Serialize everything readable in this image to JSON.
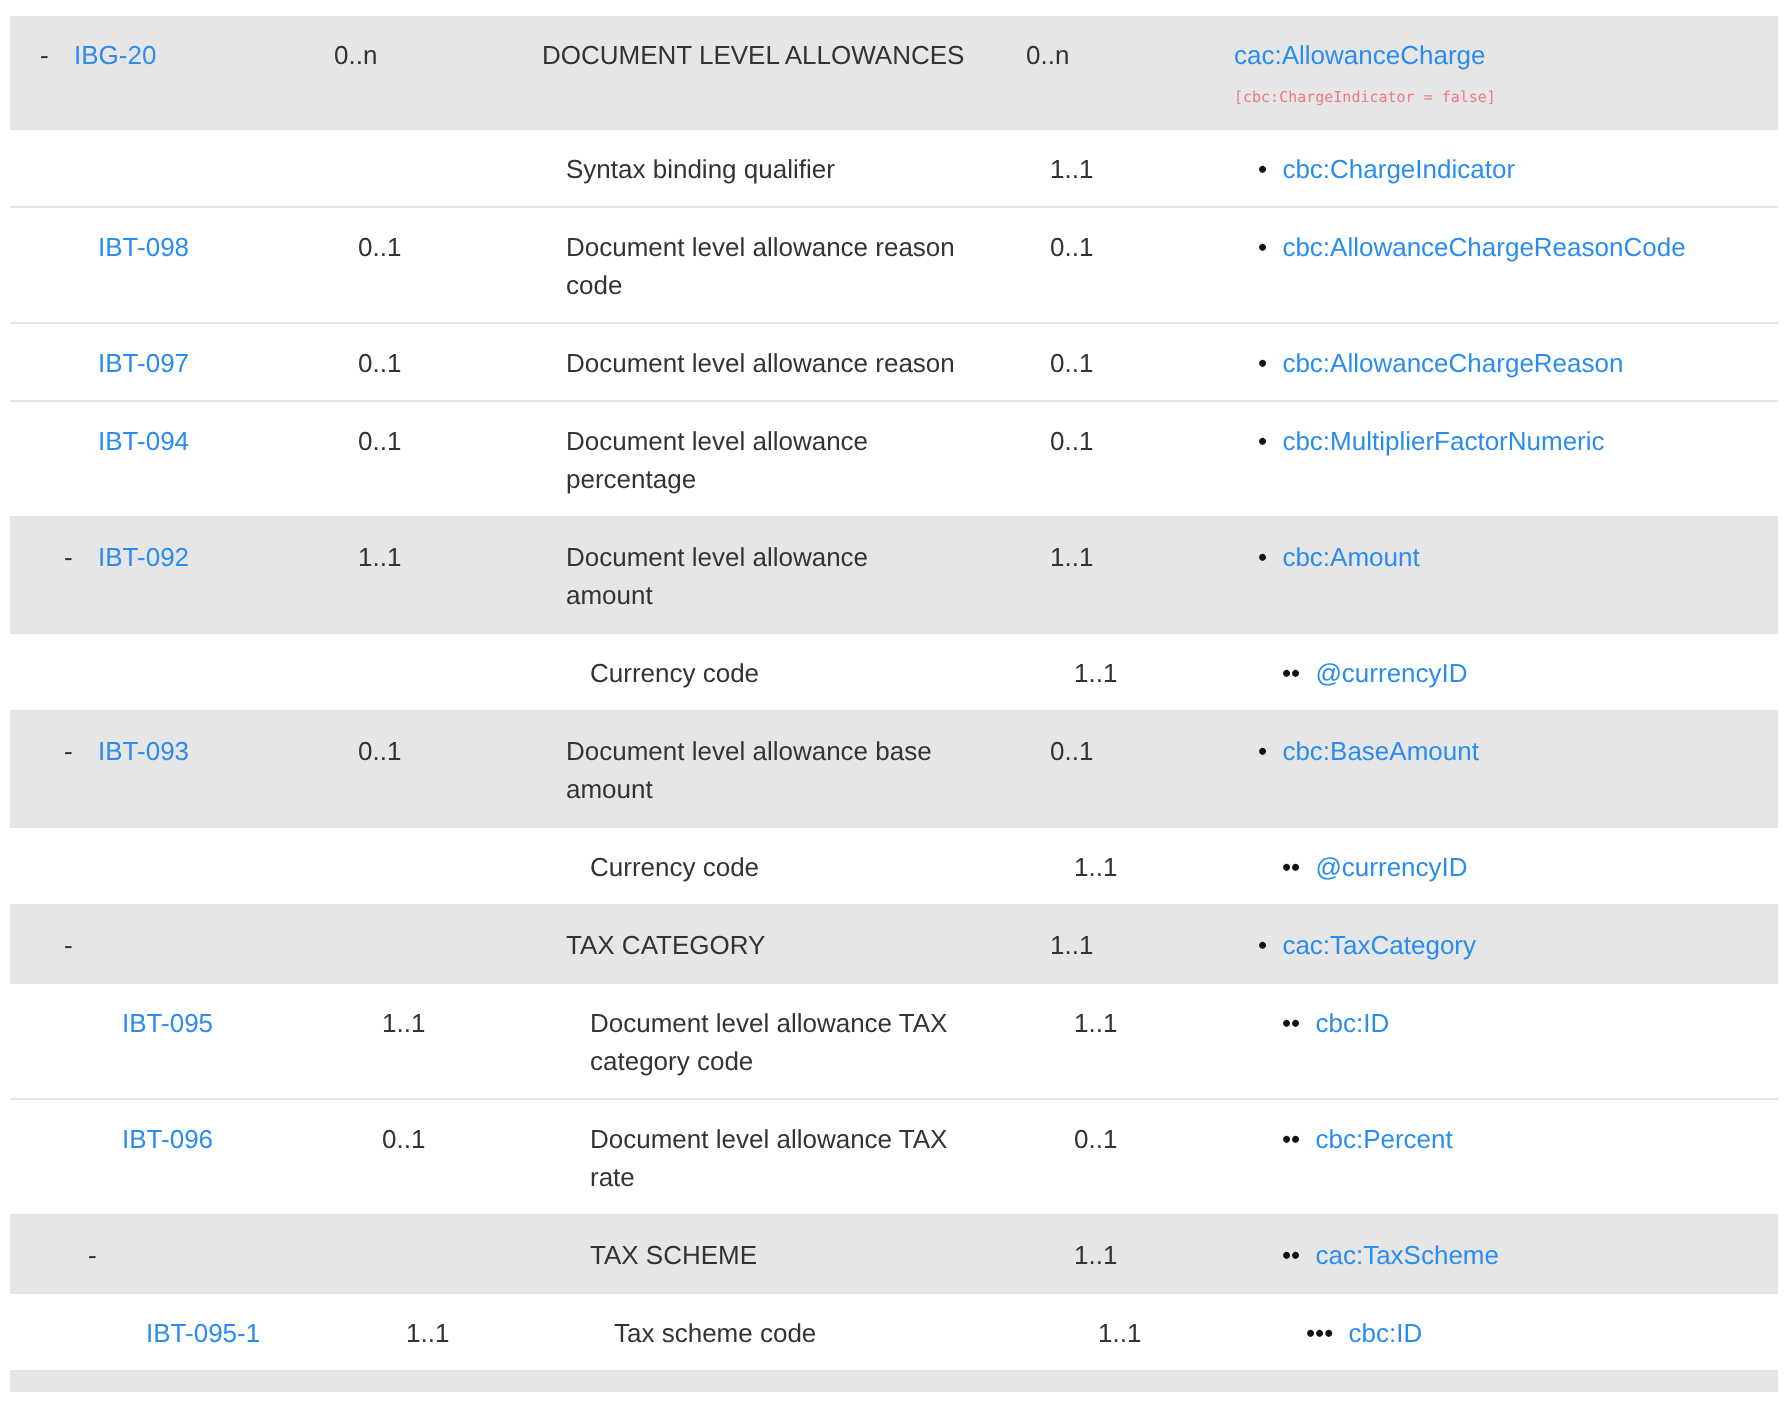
{
  "rows": [
    {
      "toggle": "-",
      "id": "IBG-20",
      "card": "0..n",
      "name": "DOCUMENT LEVEL ALLOWANCES",
      "syntax_card": "0..n",
      "path": "cac:AllowanceCharge",
      "note": "[cbc:ChargeIndicator = false]",
      "children": [
        {
          "name": "Syntax binding qualifier",
          "syntax_card": "1..1",
          "bullets": "•",
          "path": "cbc:ChargeIndicator"
        },
        {
          "id": "IBT-098",
          "card": "0..1",
          "name": "Document level allowance reason code",
          "syntax_card": "0..1",
          "bullets": "•",
          "path": "cbc:AllowanceChargeReasonCode"
        },
        {
          "id": "IBT-097",
          "card": "0..1",
          "name": "Document level allowance reason",
          "syntax_card": "0..1",
          "bullets": "•",
          "path": "cbc:AllowanceChargeReason"
        },
        {
          "id": "IBT-094",
          "card": "0..1",
          "name": "Document level allowance percentage",
          "syntax_card": "0..1",
          "bullets": "•",
          "path": "cbc:MultiplierFactorNumeric"
        },
        {
          "toggle": "-",
          "id": "IBT-092",
          "card": "1..1",
          "name": "Document level allowance amount",
          "syntax_card": "1..1",
          "bullets": "•",
          "path": "cbc:Amount",
          "children": [
            {
              "name": "Currency code",
              "syntax_card": "1..1",
              "bullets": "••",
              "path": "@currencyID"
            }
          ]
        },
        {
          "toggle": "-",
          "id": "IBT-093",
          "card": "0..1",
          "name": "Document level allowance base amount",
          "syntax_card": "0..1",
          "bullets": "•",
          "path": "cbc:BaseAmount",
          "children": [
            {
              "name": "Currency code",
              "syntax_card": "1..1",
              "bullets": "••",
              "path": "@currencyID"
            }
          ]
        },
        {
          "toggle": "-",
          "name": "TAX CATEGORY",
          "syntax_card": "1..1",
          "bullets": "•",
          "path": "cac:TaxCategory",
          "children": [
            {
              "id": "IBT-095",
              "card": "1..1",
              "name": "Document level allowance TAX category code",
              "syntax_card": "1..1",
              "bullets": "••",
              "path": "cbc:ID"
            },
            {
              "id": "IBT-096",
              "card": "0..1",
              "name": "Document level allowance TAX rate",
              "syntax_card": "0..1",
              "bullets": "••",
              "path": "cbc:Percent"
            },
            {
              "toggle": "-",
              "name": "TAX SCHEME",
              "syntax_card": "1..1",
              "bullets": "••",
              "path": "cac:TaxScheme",
              "children": [
                {
                  "id": "IBT-095-1",
                  "card": "1..1",
                  "name": "Tax scheme code",
                  "syntax_card": "1..1",
                  "bullets": "•••",
                  "path": "cbc:ID"
                }
              ]
            }
          ]
        }
      ]
    }
  ]
}
